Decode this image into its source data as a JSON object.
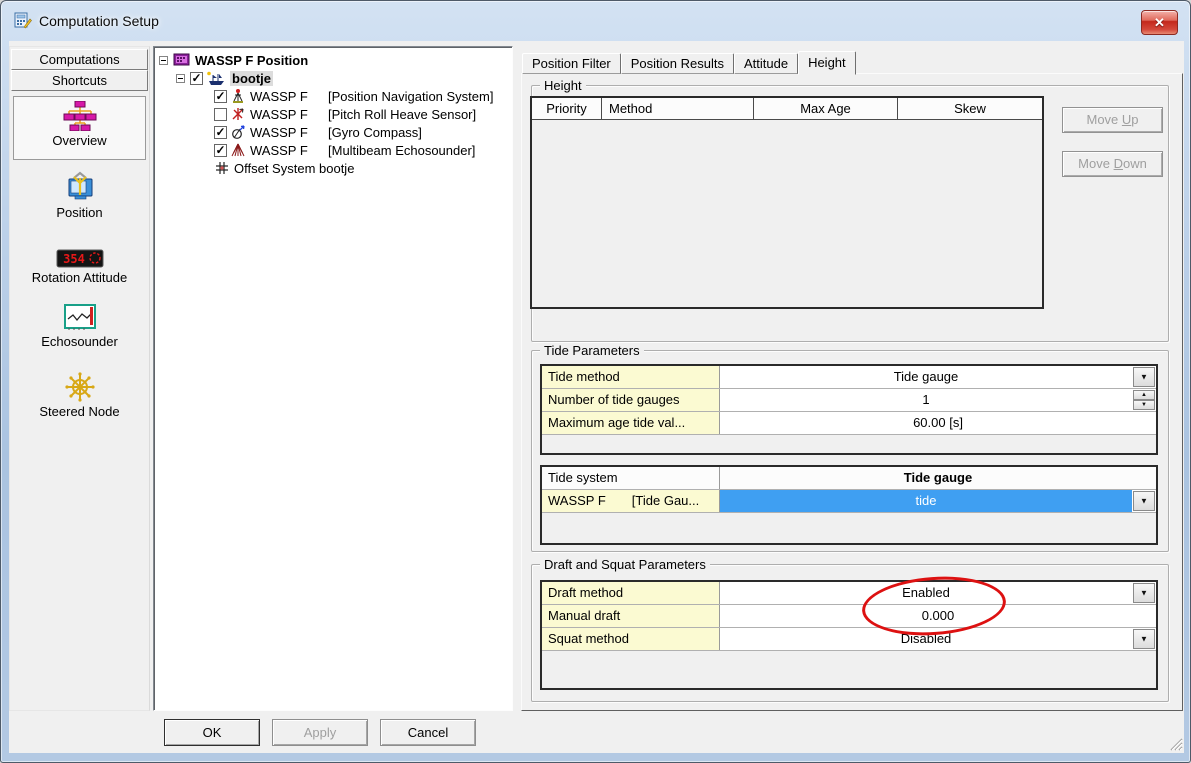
{
  "window": {
    "title": "Computation Setup",
    "close_glyph": "✕"
  },
  "sidebar": {
    "tabs": [
      {
        "label": "Computations"
      },
      {
        "label": "Shortcuts"
      }
    ],
    "items": [
      {
        "label": "Overview",
        "icon": "overview-tree-icon",
        "selected": true
      },
      {
        "label": "Position",
        "icon": "position-monitor-icon",
        "selected": false
      },
      {
        "label": "Rotation Attitude",
        "icon": "rotation-led-icon",
        "icon_text": "354",
        "selected": false
      },
      {
        "label": "Echosounder",
        "icon": "echosounder-chart-icon",
        "selected": false
      },
      {
        "label": "Steered Node",
        "icon": "steered-wheel-icon",
        "selected": false
      }
    ]
  },
  "tree": {
    "root": {
      "label": "WASSP F Position",
      "icon": "computation-node-icon"
    },
    "vessel": {
      "label": "bootje",
      "icon": "vessel-icon",
      "check": "✓"
    },
    "children": [
      {
        "check": "✓",
        "name": "WASSP F",
        "detail": "[Position Navigation System]",
        "icon": "position-nav-system-icon"
      },
      {
        "check": "",
        "name": "WASSP F",
        "detail": "[Pitch Roll Heave Sensor]",
        "icon": "pitch-roll-heave-icon"
      },
      {
        "check": "✓",
        "name": "WASSP F",
        "detail": "[Gyro Compass]",
        "icon": "gyro-compass-icon"
      },
      {
        "check": "✓",
        "name": "WASSP F",
        "detail": "[Multibeam Echosounder]",
        "icon": "multibeam-echosounder-icon"
      },
      {
        "label": "Offset System bootje",
        "icon": "offset-system-icon"
      }
    ]
  },
  "tabs": [
    {
      "label": "Position Filter",
      "active": false
    },
    {
      "label": "Position Results",
      "active": false
    },
    {
      "label": "Attitude",
      "active": false
    },
    {
      "label": "Height",
      "active": true
    }
  ],
  "height_section": {
    "group_title": "Height",
    "columns": [
      "Priority",
      "Method",
      "Max Age",
      "Skew"
    ],
    "rows": [],
    "move_up": {
      "pre": "Move ",
      "underlined": "U",
      "post": "p",
      "enabled": false
    },
    "move_down": {
      "pre": "Move ",
      "underlined": "D",
      "post": "own",
      "enabled": false
    }
  },
  "tide_section": {
    "group_title": "Tide Parameters",
    "properties": [
      {
        "name": "Tide method",
        "value": "Tide gauge",
        "control": "dropdown"
      },
      {
        "name": "Number of tide gauges",
        "value": "1",
        "control": "spinner"
      },
      {
        "name": "Maximum age tide val...",
        "value": "60.00 [s]",
        "control": "none"
      }
    ],
    "system_table": {
      "header_name": "Tide system",
      "header_value": "Tide gauge",
      "row": {
        "name": "WASSP F",
        "detail": "[Tide Gau...",
        "value": "tide",
        "selected": true,
        "control": "dropdown"
      }
    }
  },
  "draft_section": {
    "group_title": "Draft and Squat Parameters",
    "properties": [
      {
        "name": "Draft method",
        "value": "Enabled",
        "control": "dropdown"
      },
      {
        "name": "Manual draft",
        "value": "0.000",
        "control": "none"
      },
      {
        "name": "Squat method",
        "value": "Disabled",
        "control": "dropdown"
      }
    ],
    "annotation": {
      "shape": "red-ellipse",
      "color": "#dd1111",
      "around": [
        "Enabled",
        "0.000"
      ]
    }
  },
  "footer": {
    "buttons": [
      {
        "label": "OK",
        "enabled": true,
        "default": true
      },
      {
        "label": "Apply",
        "enabled": false,
        "default": false
      },
      {
        "label": "Cancel",
        "enabled": true,
        "default": false
      }
    ]
  },
  "colors": {
    "selection_blue": "#3f9ff2",
    "property_label_bg": "#fbfad2",
    "annotation_red": "#dd1111",
    "titlebar_blue": "#b7cde6"
  }
}
